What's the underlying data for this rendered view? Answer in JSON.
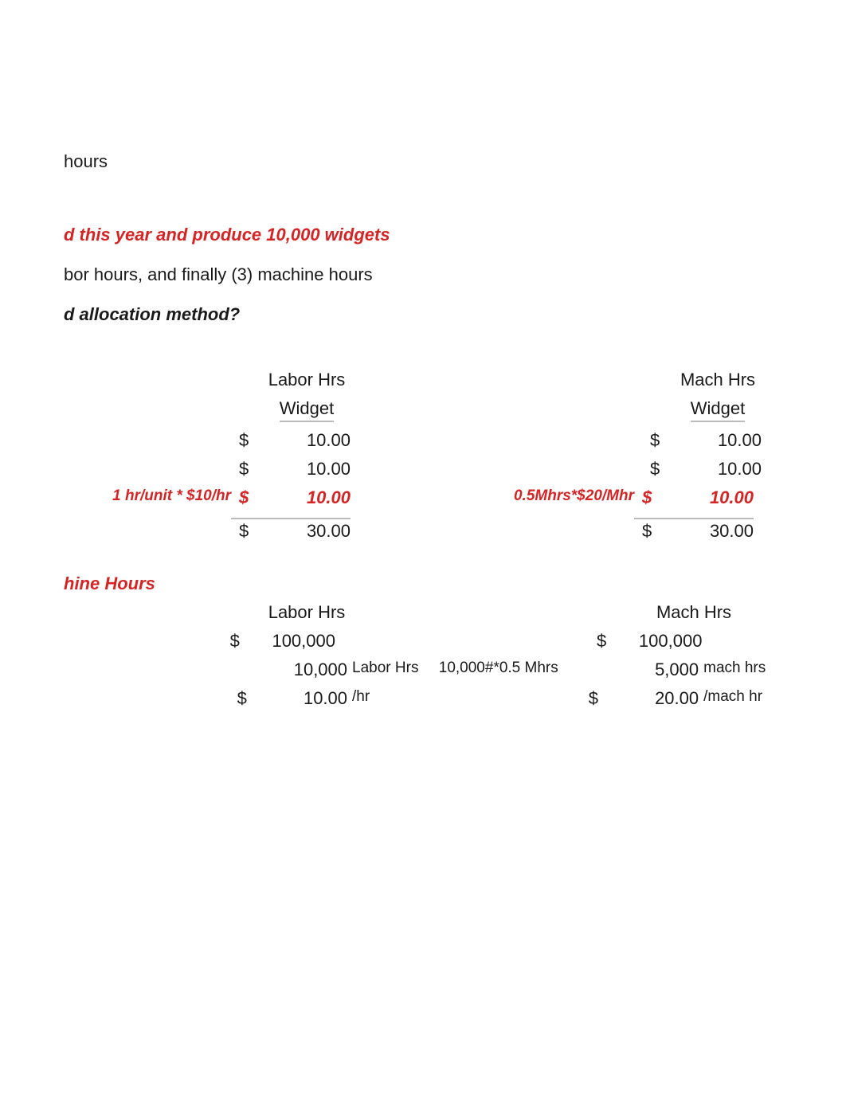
{
  "top": {
    "hours": "hours"
  },
  "headings": {
    "line1": "d this year and produce 10,000 widgets",
    "line2": "bor hours, and finally (3) machine hours",
    "line3": "d allocation method?"
  },
  "table1": {
    "labor": {
      "header": "Labor Hrs",
      "subheader": "Widget",
      "formula": "1 hr/unit * $10/hr",
      "rows": [
        {
          "sym": "$",
          "val": "10.00"
        },
        {
          "sym": "$",
          "val": "10.00"
        },
        {
          "sym": "$",
          "val": "10.00"
        },
        {
          "sym": "$",
          "val": "30.00"
        }
      ]
    },
    "mach": {
      "header": "Mach Hrs",
      "subheader": "Widget",
      "formula": "0.5Mhrs*$20/Mhr",
      "rows": [
        {
          "sym": "$",
          "val": "10.00"
        },
        {
          "sym": "$",
          "val": "10.00"
        },
        {
          "sym": "$",
          "val": "10.00"
        },
        {
          "sym": "$",
          "val": "30.00"
        }
      ]
    }
  },
  "hine_hours_heading": "hine Hours",
  "table2": {
    "labor": {
      "header": "Labor Hrs",
      "rows": [
        {
          "sym": "$",
          "val": "100,000",
          "unit": ""
        },
        {
          "sym": "",
          "val": "10,000",
          "unit": "Labor Hrs"
        },
        {
          "sym": "$",
          "val": "10.00",
          "unit": "/hr"
        }
      ]
    },
    "mach": {
      "header": "Mach Hrs",
      "formula": "10,000#*0.5 Mhrs",
      "rows": [
        {
          "sym": "$",
          "val": "100,000",
          "unit": ""
        },
        {
          "sym": "",
          "val": "5,000",
          "unit": "mach hrs"
        },
        {
          "sym": "$",
          "val": "20.00",
          "unit": "/mach hr"
        }
      ]
    }
  }
}
